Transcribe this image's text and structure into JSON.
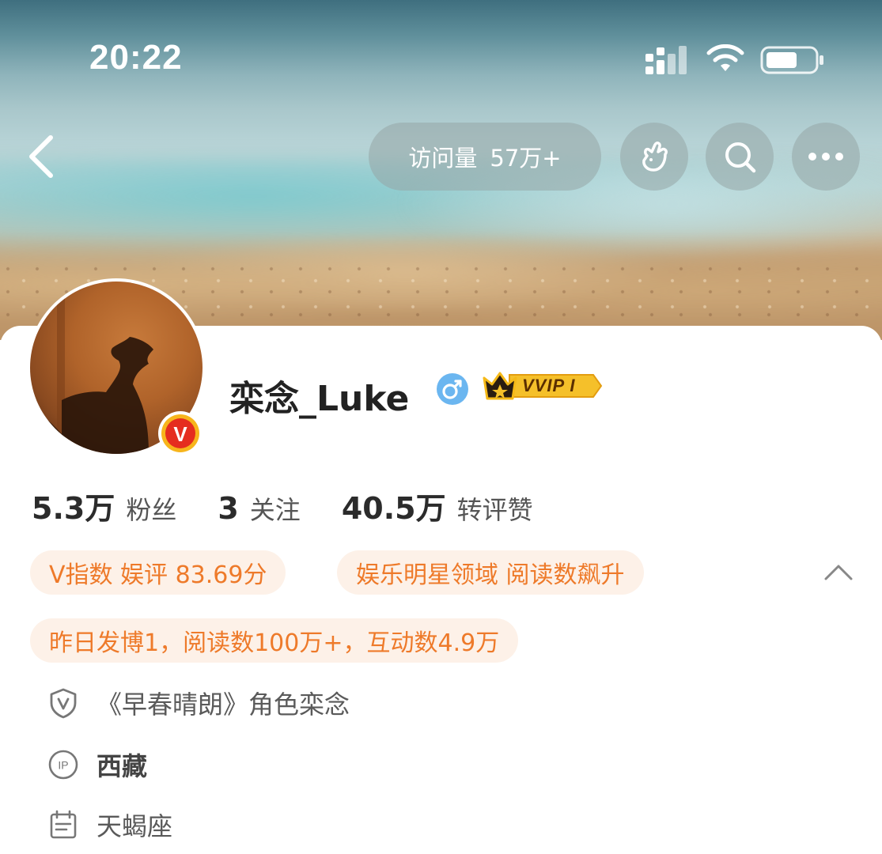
{
  "status_bar": {
    "time": "20:22"
  },
  "header": {
    "visits_label": "访问量",
    "visits_value": "57万+"
  },
  "profile": {
    "name": "栾念_Luke",
    "gender": "male",
    "vip_label": "VVIP I",
    "verified_badge_letter": "V"
  },
  "stats": [
    {
      "value": "5.3万",
      "label": "粉丝"
    },
    {
      "value": "3",
      "label": "关注"
    },
    {
      "value": "40.5万",
      "label": "转评赞"
    }
  ],
  "tags": {
    "v_index": "V指数 娱评 83.69分",
    "domain": "娱乐明星领域 阅读数飙升",
    "yesterday": "昨日发博1，阅读数100万+，互动数4.9万"
  },
  "info": {
    "verification": "《早春晴朗》角色栾念",
    "ip_location": "西藏",
    "ip_icon_label": "IP",
    "zodiac": "天蝎座"
  },
  "colors": {
    "accent_orange": "#ee7a2a",
    "tag_background": "#fdf1e8",
    "gender_blue": "#6bb6f0",
    "vip_gold": "#f5b918"
  }
}
